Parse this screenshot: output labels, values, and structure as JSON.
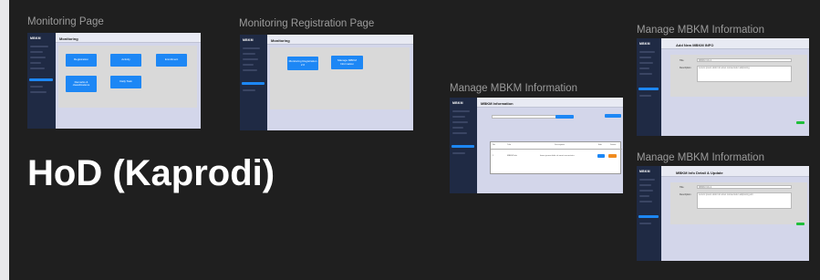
{
  "headline": "HoD (Kaprodi)",
  "app": {
    "logo": "MBKM"
  },
  "frames": {
    "monitoring": {
      "label": "Monitoring Page",
      "title": "Monitoring",
      "buttons": [
        "Registration",
        "Activity",
        "Enrollment",
        "Remarks & classifications",
        "Daily Task"
      ]
    },
    "monitoring_registration": {
      "label": "Monitoring Registration Page",
      "title": "Monitoring",
      "buttons": [
        "Monitoring Registration 2.0",
        "Manage MBKM Information"
      ]
    },
    "manage_info": {
      "label": "Manage MBKM Information",
      "title": "MBKM Information",
      "table_headers": [
        "No",
        "Title",
        "Description",
        "Edit",
        "Delete"
      ],
      "row": [
        "1",
        "MBKM Info",
        "lorem ipsum dolor sit amet consectetur"
      ]
    },
    "add_info": {
      "label": "Manage MBKM Information",
      "title": "Add New MBKM INFO",
      "field_labels": [
        "Title",
        "Description"
      ],
      "field_values": [
        "MBKM Info 1",
        "Lorem ipsum dolor sit amet consectetur adipiscing"
      ]
    },
    "detail_info": {
      "label": "Manage MBKM Information",
      "title": "MBKM Info Detail & Update",
      "field_labels": [
        "Title",
        "Description"
      ],
      "field_values": [
        "MBKM Info 1",
        "Lorem ipsum dolor sit amet consectetur adipiscing elit"
      ]
    }
  },
  "colors": {
    "canvas": "#1f1f1f",
    "sidebar": "#1f2a44",
    "primary_button": "#1d87f5",
    "save_button": "#1fbf3a",
    "delete_button": "#f08b1e",
    "content_bg": "#d3d6ea"
  }
}
